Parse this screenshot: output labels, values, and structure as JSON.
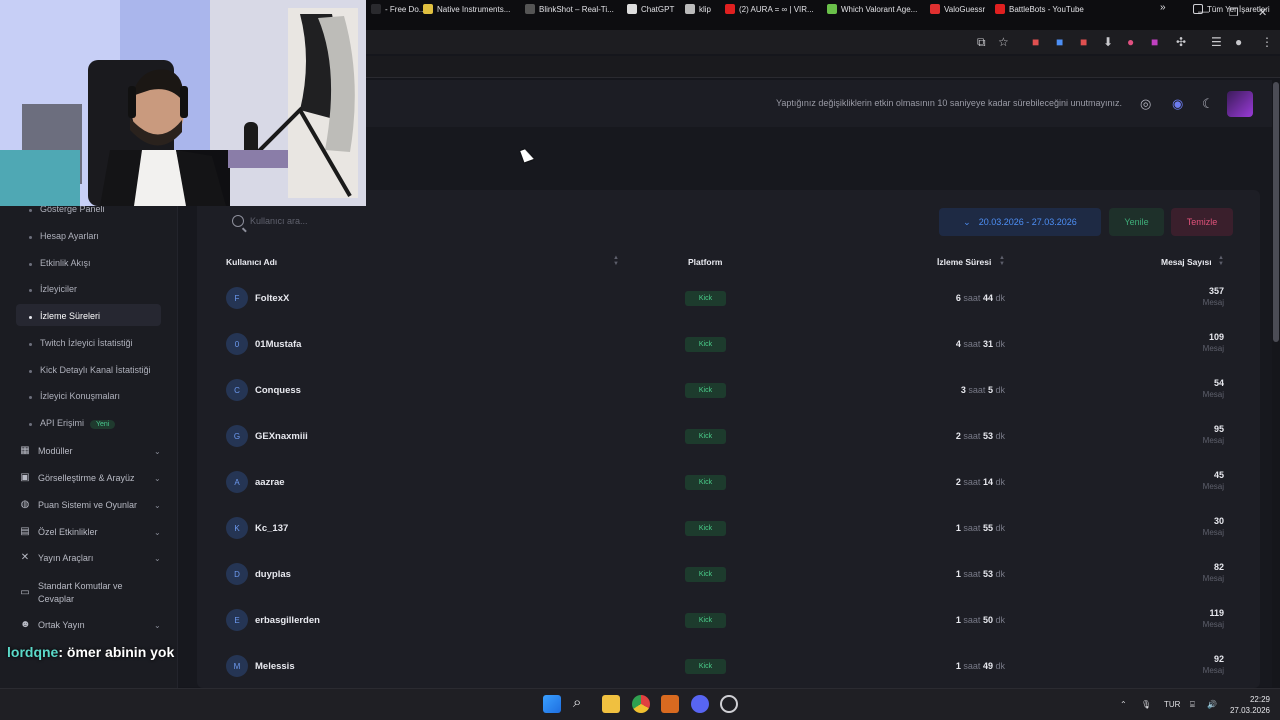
{
  "browser": {
    "bookmarks": [
      {
        "label": "- Free Do...",
        "color": "#2a2a2e"
      },
      {
        "label": "Native Instruments...",
        "color": "#e0c040"
      },
      {
        "label": "BlinkShot – Real-Ti...",
        "color": "#555555"
      },
      {
        "label": "ChatGPT",
        "color": "#dddddd"
      },
      {
        "label": "klip",
        "color": "#bbbbbb"
      },
      {
        "label": "(2) AURA = ∞ | VIR...",
        "color": "#e02020"
      },
      {
        "label": "Which Valorant Age...",
        "color": "#6ac04a"
      },
      {
        "label": "ValoGuessr",
        "color": "#e03030"
      },
      {
        "label": "BattleBots - YouTube",
        "color": "#e02020"
      }
    ],
    "all_bookmarks_label": "Tüm Yer İşaretleri",
    "more_label": "»"
  },
  "header": {
    "notice": "Yaptığınız değişikliklerin etkin olmasının 10 saniyeye kadar sürebileceğini unutmayınız."
  },
  "sidebar": {
    "sub_items": [
      {
        "label": "Gösterge Paneli",
        "active": false
      },
      {
        "label": "Hesap Ayarları",
        "active": false
      },
      {
        "label": "Etkinlik Akışı",
        "active": false
      },
      {
        "label": "İzleyiciler",
        "active": false
      },
      {
        "label": "İzleme Süreleri",
        "active": true
      },
      {
        "label": "Twitch İzleyici İstatistiği",
        "active": false
      },
      {
        "label": "Kick Detaylı Kanal İstatistiği",
        "active": false
      },
      {
        "label": "İzleyici Konuşmaları",
        "active": false
      },
      {
        "label": "API Erişimi",
        "active": false,
        "badge": "Yeni"
      }
    ],
    "groups": [
      {
        "label": "Modüller",
        "icon": "grid-icon"
      },
      {
        "label": "Görselleştirme & Arayüz",
        "icon": "image-icon"
      },
      {
        "label": "Puan Sistemi ve Oyunlar",
        "icon": "gamepad-icon"
      },
      {
        "label": "Özel Etkinlikler",
        "icon": "calendar-icon"
      },
      {
        "label": "Yayın Araçları",
        "icon": "tools-icon"
      },
      {
        "label": "Standart Komutlar ve",
        "label2": "Cevaplar",
        "icon": "keyboard-icon"
      },
      {
        "label": "Ortak Yayın",
        "icon": "users-icon"
      }
    ]
  },
  "toolbar": {
    "search_placeholder": "Kullanıcı ara...",
    "date_range": "20.03.2026 - 27.03.2026",
    "refresh_label": "Yenile",
    "clear_label": "Temizle"
  },
  "table": {
    "headers": {
      "username": "Kullanıcı Adı",
      "platform": "Platform",
      "watch_time": "İzleme Süresi",
      "messages": "Mesaj Sayısı"
    },
    "hours_unit": "saat",
    "minutes_unit": "dk",
    "messages_unit": "Mesaj",
    "rows": [
      {
        "initial": "F",
        "name": "FoltexX",
        "platform": "Kick",
        "hours": "6",
        "minutes": "44",
        "messages": "357"
      },
      {
        "initial": "0",
        "name": "01Mustafa",
        "platform": "Kick",
        "hours": "4",
        "minutes": "31",
        "messages": "109"
      },
      {
        "initial": "C",
        "name": "Conquess",
        "platform": "Kick",
        "hours": "3",
        "minutes": "5",
        "messages": "54"
      },
      {
        "initial": "G",
        "name": "GEXnaxmiii",
        "platform": "Kick",
        "hours": "2",
        "minutes": "53",
        "messages": "95"
      },
      {
        "initial": "A",
        "name": "aazrae",
        "platform": "Kick",
        "hours": "2",
        "minutes": "14",
        "messages": "45"
      },
      {
        "initial": "K",
        "name": "Kc_137",
        "platform": "Kick",
        "hours": "1",
        "minutes": "55",
        "messages": "30"
      },
      {
        "initial": "D",
        "name": "duyplas",
        "platform": "Kick",
        "hours": "1",
        "minutes": "53",
        "messages": "82"
      },
      {
        "initial": "E",
        "name": "erbasgillerden",
        "platform": "Kick",
        "hours": "1",
        "minutes": "50",
        "messages": "119"
      },
      {
        "initial": "M",
        "name": "Melessis",
        "platform": "Kick",
        "hours": "1",
        "minutes": "49",
        "messages": "92"
      }
    ]
  },
  "overlay": {
    "chat_user": "lordqne",
    "chat_sep": ":",
    "chat_message": "ömer abinin yok"
  },
  "taskbar": {
    "language": "TUR",
    "time": "22:29",
    "date": "27.03.2026"
  },
  "colors": {
    "accent_blue": "#4d8ff5",
    "accent_green": "#3fae7a",
    "accent_red": "#e0527a",
    "kick_green": "#4cd08c"
  }
}
